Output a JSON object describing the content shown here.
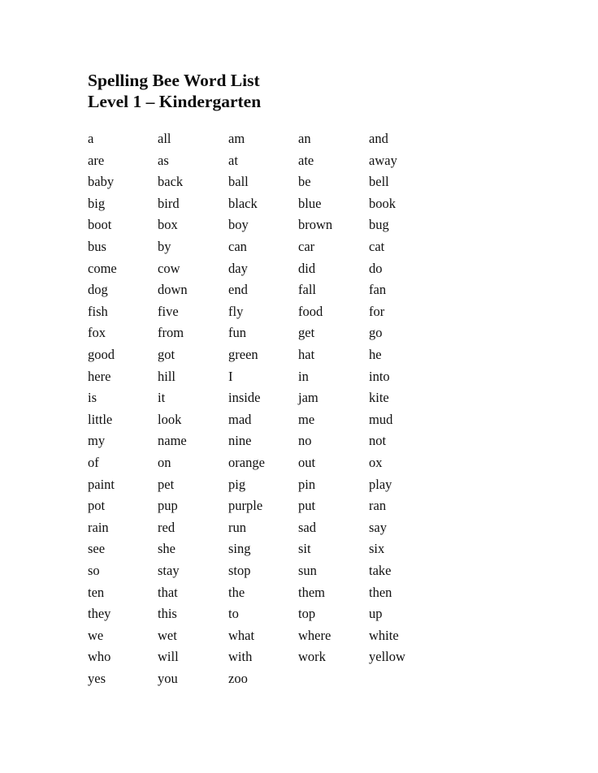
{
  "document": {
    "title_line1": "Spelling Bee Word List",
    "title_line2": "Level 1 – Kindergarten",
    "rows": [
      [
        "a",
        "all",
        "am",
        "an",
        "and"
      ],
      [
        "are",
        "as",
        "at",
        "ate",
        "away"
      ],
      [
        "baby",
        "back",
        "ball",
        "be",
        "bell"
      ],
      [
        "big",
        "bird",
        "black",
        "blue",
        "book"
      ],
      [
        "boot",
        "box",
        "boy",
        "brown",
        "bug"
      ],
      [
        "bus",
        "by",
        "can",
        "car",
        "cat"
      ],
      [
        "come",
        "cow",
        "day",
        "did",
        "do"
      ],
      [
        "dog",
        "down",
        "end",
        "fall",
        "fan"
      ],
      [
        "fish",
        "five",
        "fly",
        "food",
        "for"
      ],
      [
        "fox",
        "from",
        "fun",
        "get",
        "go"
      ],
      [
        "good",
        "got",
        "green",
        "hat",
        "he"
      ],
      [
        "here",
        "hill",
        "I",
        "in",
        "into"
      ],
      [
        "is",
        "it",
        "inside",
        "jam",
        "kite"
      ],
      [
        "little",
        "look",
        "mad",
        "me",
        "mud"
      ],
      [
        "my",
        "name",
        "nine",
        "no",
        "not"
      ],
      [
        "of",
        "on",
        "orange",
        "out",
        "ox"
      ],
      [
        "paint",
        "pet",
        "pig",
        "pin",
        "play"
      ],
      [
        "pot",
        "pup",
        "purple",
        "put",
        "ran"
      ],
      [
        "rain",
        "red",
        "run",
        "sad",
        "say"
      ],
      [
        "see",
        "she",
        "sing",
        "sit",
        "six"
      ],
      [
        "so",
        "stay",
        "stop",
        "sun",
        "take"
      ],
      [
        "ten",
        "that",
        "the",
        "them",
        "then"
      ],
      [
        "they",
        "this",
        "to",
        "top",
        "up"
      ],
      [
        "we",
        "wet",
        "what",
        "where",
        "white"
      ],
      [
        "who",
        "will",
        "with",
        "work",
        "yellow"
      ],
      [
        "yes",
        "you",
        "zoo",
        "",
        ""
      ]
    ]
  }
}
